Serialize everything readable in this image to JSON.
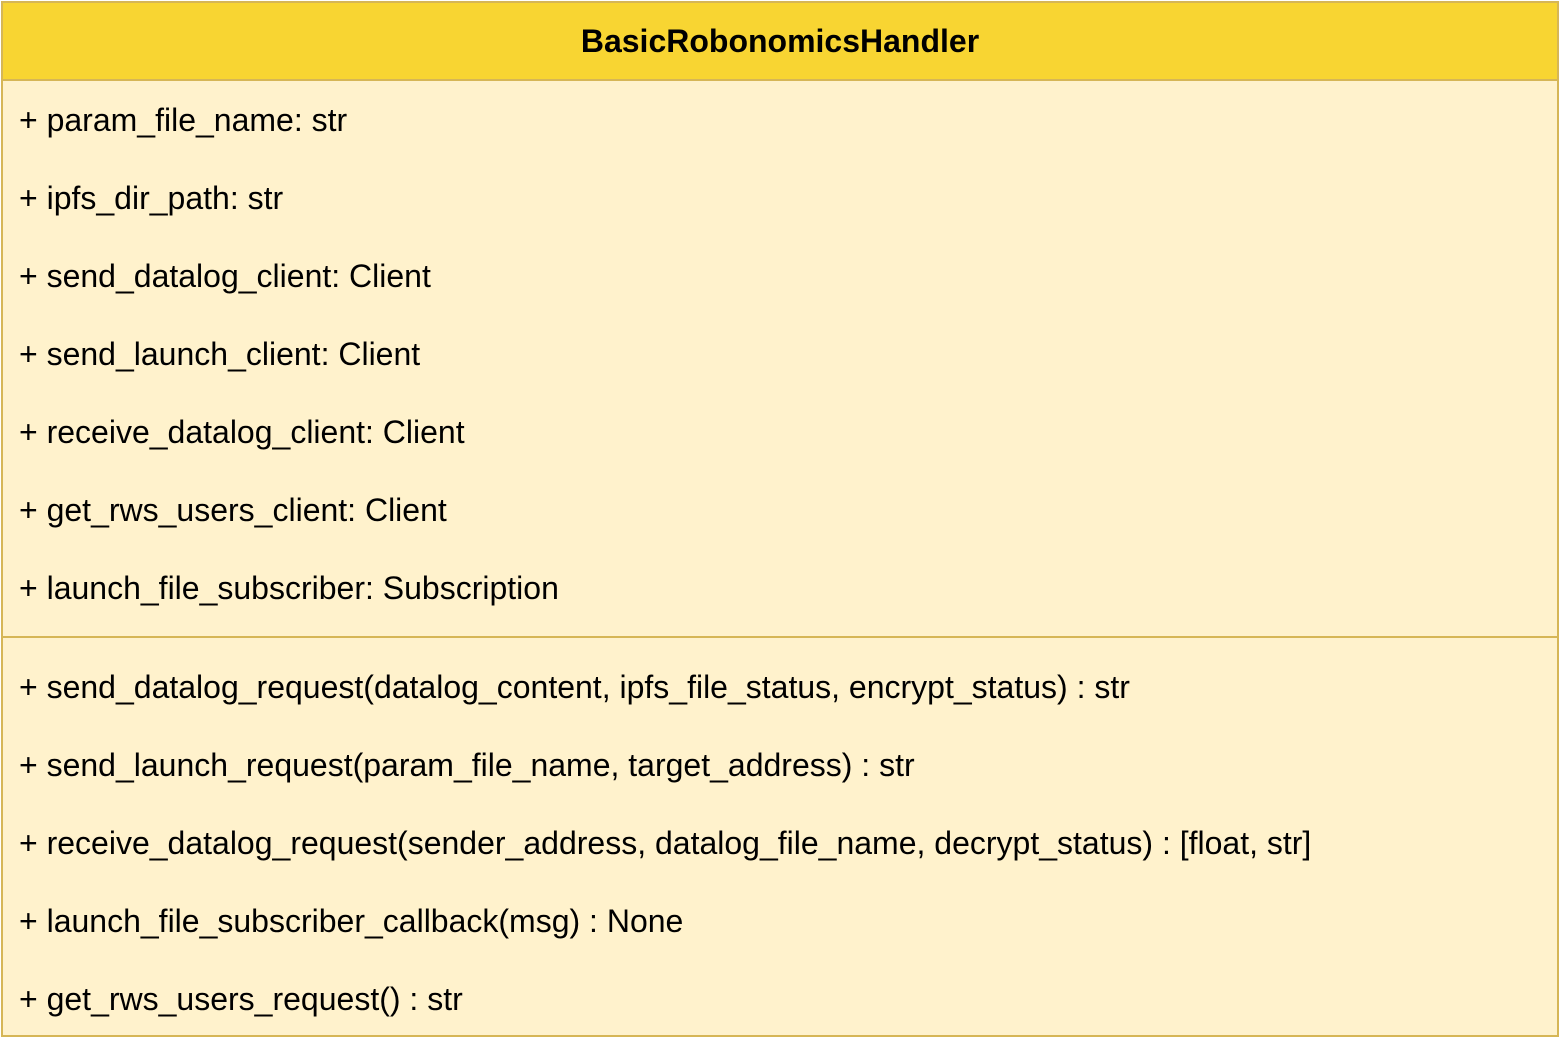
{
  "class": {
    "name": "BasicRobonomicsHandler",
    "attributes": [
      "+ param_file_name: str",
      "+ ipfs_dir_path: str",
      "+ send_datalog_client: Client",
      "+ send_launch_client: Client",
      "+ receive_datalog_client: Client",
      "+ get_rws_users_client: Client",
      "+ launch_file_subscriber: Subscription"
    ],
    "methods": [
      "+ send_datalog_request(datalog_content, ipfs_file_status, encrypt_status) : str",
      "+ send_launch_request(param_file_name, target_address) : str",
      "+ receive_datalog_request(sender_address, datalog_file_name, decrypt_status) : [float, str]",
      "+ launch_file_subscriber_callback(msg) : None",
      "+ get_rws_users_request() : str"
    ]
  },
  "colors": {
    "header_fill": "#f8d532",
    "body_fill": "#fff2cc",
    "border": "#d6b656"
  }
}
